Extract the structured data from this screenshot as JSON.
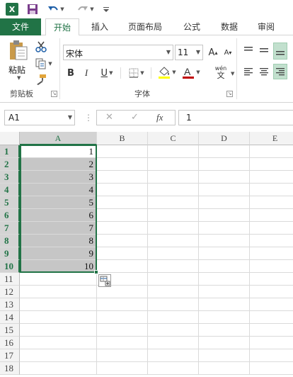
{
  "quick_access": {
    "logo_text": "X",
    "icons": [
      "excel-logo-icon",
      "save-icon",
      "undo-icon",
      "redo-icon",
      "customize-icon"
    ]
  },
  "ribbon_tabs": {
    "file": "文件",
    "home": "开始",
    "insert": "插入",
    "page_layout": "页面布局",
    "formulas": "公式",
    "data": "数据",
    "review": "审阅"
  },
  "clipboard": {
    "paste_label": "粘贴",
    "group_label": "剪贴板"
  },
  "font": {
    "name": "宋体",
    "size": "11",
    "group_label": "字体",
    "bold": "B",
    "italic": "I",
    "underline": "U",
    "phonetic": "wén",
    "grow": "A",
    "shrink": "A"
  },
  "formula_bar": {
    "name_box": "A1",
    "cancel_glyph": "✕",
    "enter_glyph": "✓",
    "fx_label": "fx",
    "value": "1"
  },
  "sheet": {
    "columns": [
      "A",
      "B",
      "C",
      "D",
      "E"
    ],
    "rows": [
      "1",
      "2",
      "3",
      "4",
      "5",
      "6",
      "7",
      "8",
      "9",
      "10",
      "11",
      "12",
      "13",
      "14",
      "15",
      "16",
      "17",
      "18"
    ],
    "col_a_values": [
      "1",
      "2",
      "3",
      "4",
      "5",
      "6",
      "7",
      "8",
      "9",
      "10"
    ]
  },
  "colors": {
    "accent": "#217346",
    "selection_fill": "#c6c6c6",
    "font_color_bar": "#c00000",
    "highlight_bar": "#ffff00"
  }
}
